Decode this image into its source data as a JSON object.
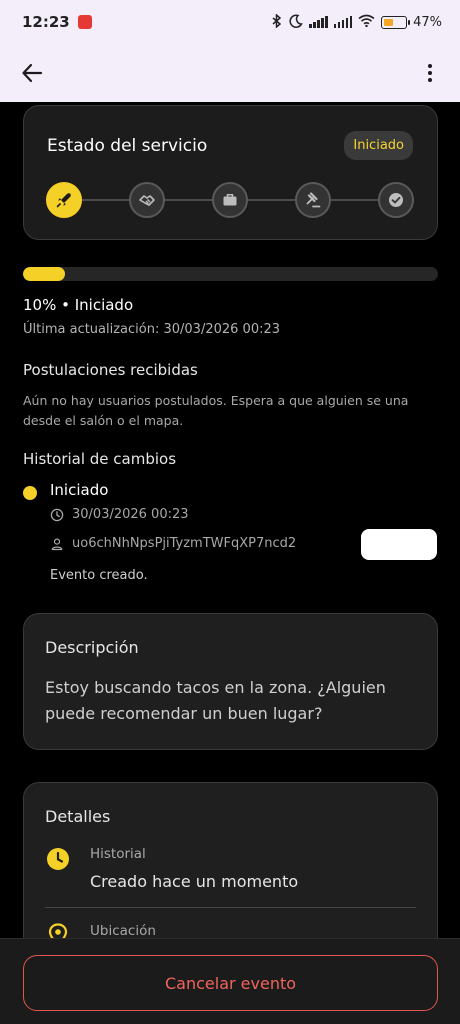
{
  "statusbar": {
    "time": "12:23",
    "battery_pct": "47%",
    "battery_level": 0.47
  },
  "status_card": {
    "title": "Estado del servicio",
    "badge": "Iniciado",
    "steps": [
      "rocket-icon",
      "handshake-icon",
      "briefcase-icon",
      "gavel-icon",
      "check-circle-icon"
    ],
    "active_step": 0
  },
  "progress": {
    "value": 0.1,
    "label": "10% • Iniciado",
    "updated": "Última actualización: 30/03/2026 00:23"
  },
  "applications": {
    "heading": "Postulaciones recibidas",
    "empty": "Aún no hay usuarios postulados. Espera a que alguien se una desde el salón o el mapa."
  },
  "history": {
    "heading": "Historial de cambios",
    "items": [
      {
        "title": "Iniciado",
        "date": "30/03/2026 00:23",
        "user": "uo6chNhNpsPjiTyzmTWFqXP7ncd2",
        "note": "Evento creado."
      }
    ]
  },
  "description": {
    "title": "Descripción",
    "text": "Estoy buscando tacos en la zona. ¿Alguien puede recomendar un buen lugar?"
  },
  "details": {
    "title": "Detalles",
    "history_label": "Historial",
    "history_value": "Creado hace un momento",
    "location_label": "Ubicación"
  },
  "actions": {
    "cancel_label": "Cancelar evento"
  },
  "colors": {
    "accent": "#f5d127",
    "danger": "#e0554f",
    "surface": "#1f1f1f"
  }
}
